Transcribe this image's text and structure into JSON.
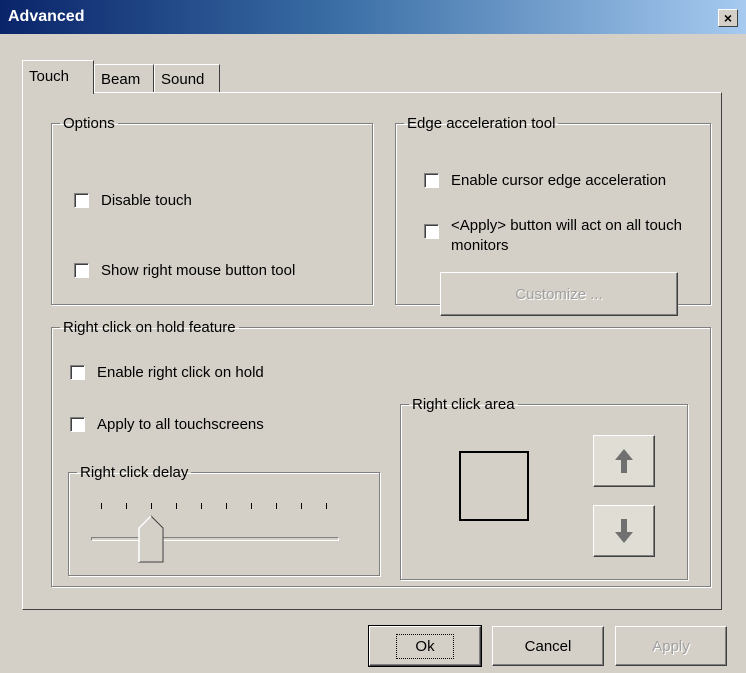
{
  "window": {
    "title": "Advanced",
    "close_label": "×"
  },
  "tabs": [
    {
      "label": "Touch",
      "active": true
    },
    {
      "label": "Beam",
      "active": false
    },
    {
      "label": "Sound",
      "active": false
    }
  ],
  "options": {
    "title": "Options",
    "disable_touch": {
      "label": "Disable touch",
      "checked": false
    },
    "show_right_mouse": {
      "label": "Show right mouse button tool",
      "checked": false
    }
  },
  "edge": {
    "title": "Edge acceleration tool",
    "enable_edge": {
      "label": "Enable cursor edge acceleration",
      "checked": false
    },
    "apply_all_monitors": {
      "label": "<Apply> button will act on all touch monitors",
      "checked": false
    },
    "customize_label": "Customize ..."
  },
  "right_click": {
    "title": "Right click on hold feature",
    "enable_hold": {
      "label": "Enable right click on hold",
      "checked": false
    },
    "apply_all_touchscreens": {
      "label": "Apply to all touchscreens",
      "checked": false
    },
    "delay": {
      "title": "Right click delay",
      "tick_count": 10,
      "value_index": 2
    },
    "area": {
      "title": "Right click area",
      "up_icon": "arrow-up-icon",
      "down_icon": "arrow-down-icon"
    }
  },
  "footer": {
    "ok_label": "Ok",
    "cancel_label": "Cancel",
    "apply_label": "Apply"
  }
}
